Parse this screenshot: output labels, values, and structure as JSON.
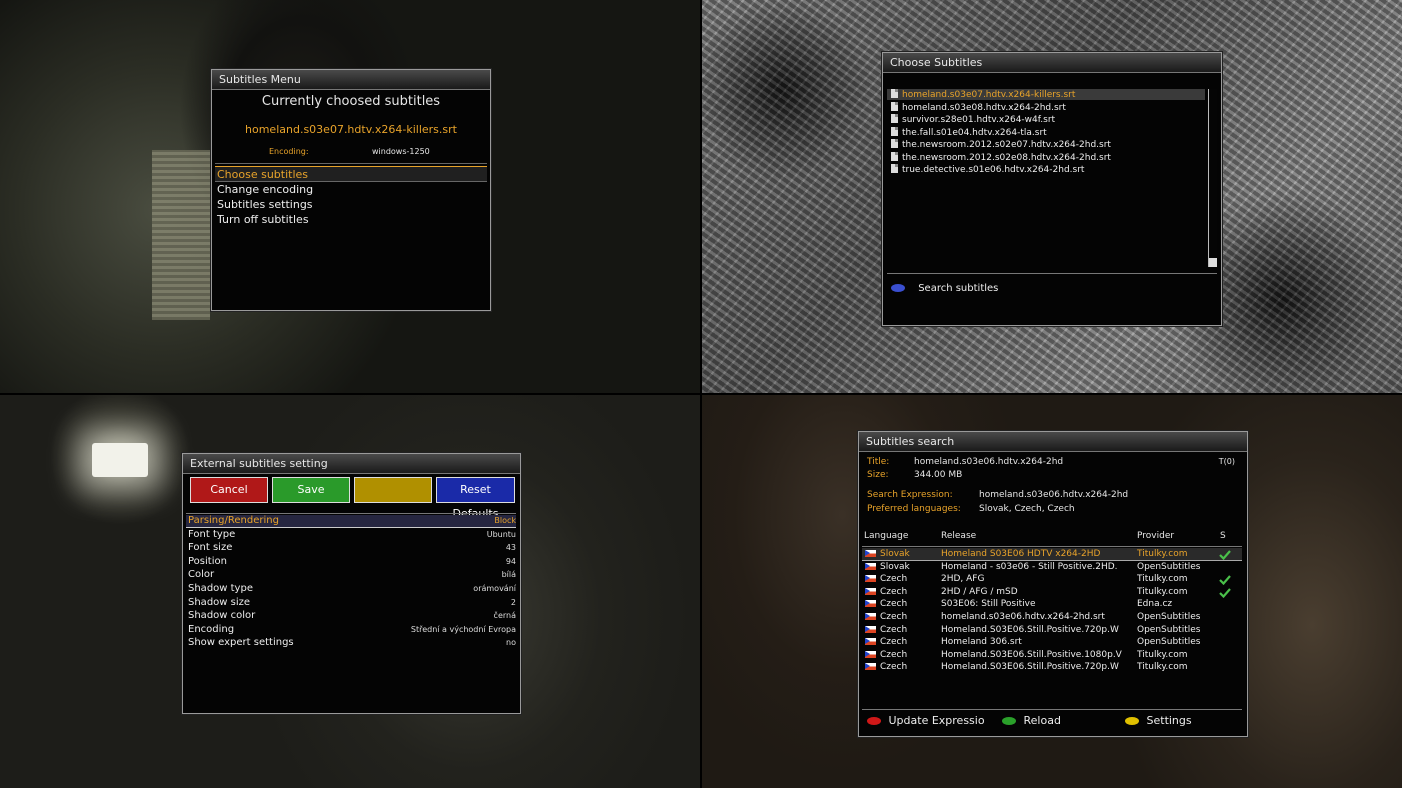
{
  "menu": {
    "title": "Subtitles Menu",
    "heading": "Currently choosed subtitles",
    "current_file": "homeland.s03e07.hdtv.x264-killers.srt",
    "encoding_label": "Encoding:",
    "encoding_value": "windows-1250",
    "items": [
      "Choose subtitles",
      "Change encoding",
      "Subtitles settings",
      "Turn off subtitles"
    ],
    "selected_index": 0
  },
  "choose": {
    "title": "Choose Subtitles",
    "files": [
      "homeland.s03e07.hdtv.x264-killers.srt",
      "homeland.s03e08.hdtv.x264-2hd.srt",
      "survivor.s28e01.hdtv.x264-w4f.srt",
      "the.fall.s01e04.hdtv.x264-tla.srt",
      "the.newsroom.2012.s02e07.hdtv.x264-2hd.srt",
      "the.newsroom.2012.s02e08.hdtv.x264-2hd.srt",
      "true.detective.s01e06.hdtv.x264-2hd.srt"
    ],
    "selected_index": 0,
    "footer_label": "Search subtitles",
    "footer_color": "#3a4fd0"
  },
  "settings": {
    "title": "External subtitles setting",
    "buttons": [
      {
        "label": "Cancel",
        "color": "#b01818"
      },
      {
        "label": "Save",
        "color": "#2a9a2a"
      },
      {
        "label": "",
        "color": "#b09000"
      },
      {
        "label": "Reset Defaults",
        "color": "#1a2aa8"
      }
    ],
    "rows": [
      {
        "label": "Parsing/Rendering",
        "value": "Block"
      },
      {
        "label": "Font type",
        "value": "Ubuntu"
      },
      {
        "label": "Font size",
        "value": "43"
      },
      {
        "label": "Position",
        "value": "94"
      },
      {
        "label": "Color",
        "value": "bílá"
      },
      {
        "label": "Shadow type",
        "value": "orámování"
      },
      {
        "label": "Shadow size",
        "value": "2"
      },
      {
        "label": "Shadow color",
        "value": "černá"
      },
      {
        "label": "Encoding",
        "value": "Střední a východní Evropa"
      },
      {
        "label": "Show expert settings",
        "value": "no"
      }
    ],
    "selected_index": 0
  },
  "search": {
    "title": "Subtitles search",
    "title_label": "Title:",
    "title_value": "homeland.s03e06.hdtv.x264-2hd",
    "size_label": "Size:",
    "size_value": "344.00 MB",
    "corner": "T(0)",
    "expr_label": "Search Expression:",
    "expr_value": "homeland.s03e06.hdtv.x264-2hd",
    "lang_label": "Preferred languages:",
    "lang_value": "Slovak, Czech, Czech",
    "columns": {
      "language": "Language",
      "release": "Release",
      "provider": "Provider",
      "s": "S"
    },
    "results": [
      {
        "language": "Slovak",
        "release": "Homeland S03E06 HDTV x264-2HD",
        "provider": "Titulky.com",
        "check": true
      },
      {
        "language": "Slovak",
        "release": "Homeland - s03e06 - Still Positive.2HD.",
        "provider": "OpenSubtitles",
        "check": false
      },
      {
        "language": "Czech",
        "release": "2HD, AFG",
        "provider": "Titulky.com",
        "check": true
      },
      {
        "language": "Czech",
        "release": "2HD / AFG / mSD",
        "provider": "Titulky.com",
        "check": true
      },
      {
        "language": "Czech",
        "release": "S03E06: Still Positive",
        "provider": "Edna.cz",
        "check": false
      },
      {
        "language": "Czech",
        "release": "homeland.s03e06.hdtv.x264-2hd.srt",
        "provider": "OpenSubtitles",
        "check": false
      },
      {
        "language": "Czech",
        "release": "Homeland.S03E06.Still.Positive.720p.W",
        "provider": "OpenSubtitles",
        "check": false
      },
      {
        "language": "Czech",
        "release": "Homeland 306.srt",
        "provider": "OpenSubtitles",
        "check": false
      },
      {
        "language": "Czech",
        "release": "Homeland.S03E06.Still.Positive.1080p.V",
        "provider": "Titulky.com",
        "check": false
      },
      {
        "language": "Czech",
        "release": "Homeland.S03E06.Still.Positive.720p.W",
        "provider": "Titulky.com",
        "check": false
      }
    ],
    "selected_index": 0,
    "footer": [
      {
        "label": "Update Expressio",
        "color": "#d01818"
      },
      {
        "label": "Reload",
        "color": "#2aa02a"
      },
      {
        "label": "Settings",
        "color": "#e0c000"
      }
    ],
    "check_color": "#4ac04a"
  }
}
